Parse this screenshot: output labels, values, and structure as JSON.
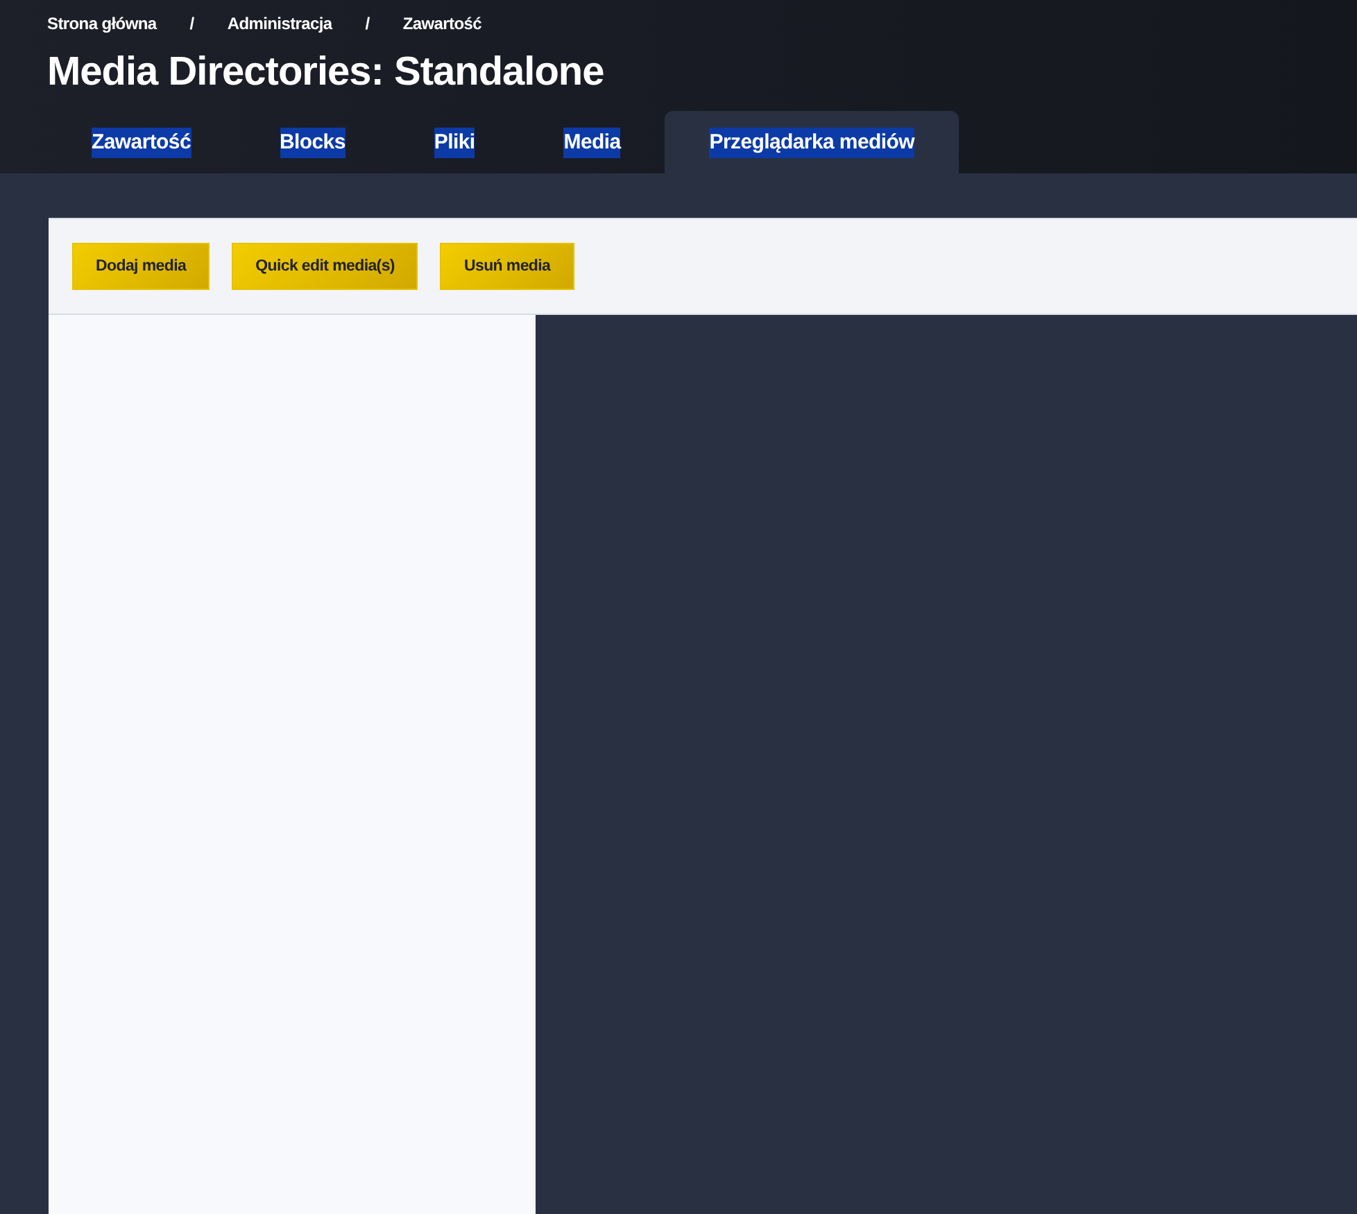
{
  "breadcrumb": [
    "Strona główna",
    "Administracja",
    "Zawartość"
  ],
  "breadcrumb_separator": "/",
  "title": "Media Directories: Standalone",
  "tabs": [
    {
      "label": "Zawartość",
      "selected": false
    },
    {
      "label": "Blocks",
      "selected": false
    },
    {
      "label": "Pliki",
      "selected": false
    },
    {
      "label": "Media",
      "selected": false
    },
    {
      "label": "Przeglądarka mediów",
      "selected": true
    }
  ],
  "toolbar": {
    "buttons": [
      "Dodaj media",
      "Quick edit media(s)",
      "Usuń media"
    ]
  }
}
